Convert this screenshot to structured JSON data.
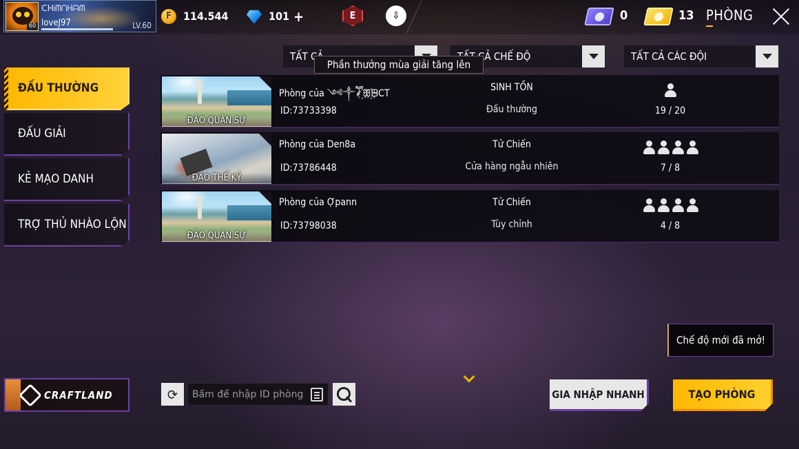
{
  "profile": {
    "name": "ᑕᕼᎥᗰᑎᕼᗩᗰ",
    "sub": "loveJ97",
    "level": "LV.60",
    "avatar_level": "60"
  },
  "currency": {
    "gold": "114.544",
    "gold_symbol": "F",
    "diamonds": "101",
    "diamond_plus": "+"
  },
  "top_icons": {
    "event_letter": "E",
    "cloud_symbol": "⇩"
  },
  "tickets": {
    "purple_count": "0",
    "gold_count": "13"
  },
  "page": {
    "title": "PHÒNG"
  },
  "filters": {
    "type": "TẤT CẢ",
    "mode": "TẤT CẢ CHẾ ĐỘ",
    "teams": "TẤT CẢ CÁC ĐỘI"
  },
  "tooltip": "Phần thưởng mùa giải tăng lên",
  "sidebar": {
    "tabs": [
      {
        "label": "ĐẤU THƯỜNG",
        "active": true
      },
      {
        "label": "ĐẤU GIẢI",
        "active": false
      },
      {
        "label": "KẺ MẠO DANH",
        "active": false
      },
      {
        "label": "TRỢ THỦ NHÀO LỘN",
        "active": false
      }
    ]
  },
  "rooms": [
    {
      "map": "ĐẢO QUÂN SỰ",
      "name": "Phòng của ༺༒ཽ⸙꙰ꕥ꙰ᗸCT",
      "id": "ID:73733398",
      "mode": "SINH TỒN",
      "sub": "Đấu thường",
      "team_size": 1,
      "count": "19 / 20"
    },
    {
      "map": "ĐẢO THẾ KỶ",
      "name": "Phòng của Den8a",
      "id": "ID:73786448",
      "mode": "Tử Chiến",
      "sub": "Cửa hàng ngẫu nhiên",
      "team_size": 4,
      "count": "7 / 8"
    },
    {
      "map": "ĐẢO QUÂN SỰ",
      "name": "Phòng của Ợpann",
      "id": "ID:73798038",
      "mode": "Tử Chiến",
      "sub": "Tùy chỉnh",
      "team_size": 4,
      "count": "4 / 8"
    }
  ],
  "notice": "Chế độ mới đã mở!",
  "craftland": {
    "label": "CRAFTLAND"
  },
  "search": {
    "placeholder": "Bấm để nhập ID phòng",
    "refresh_symbol": "⟳"
  },
  "buttons": {
    "quick_join": "GIA NHẬP NHANH",
    "create_room": "TẠO PHÒNG"
  },
  "colors": {
    "accent_yellow": "#ffc81a",
    "accent_purple": "#6d3fa4",
    "background": "#2b2238"
  }
}
